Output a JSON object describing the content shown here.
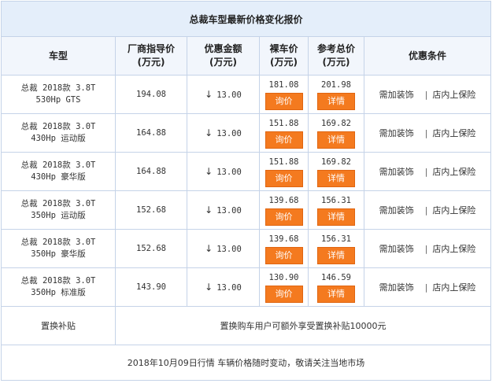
{
  "title": "总裁车型最新价格变化报价",
  "headers": {
    "model": "车型",
    "msrp": [
      "厂商指导价",
      "(万元)"
    ],
    "discount": [
      "优惠金额",
      "(万元)"
    ],
    "net": [
      "裸车价",
      "(万元)"
    ],
    "total": [
      "参考总价",
      "(万元)"
    ],
    "cond": "优惠条件"
  },
  "rows": [
    {
      "model": [
        "总裁 2018款 3.8T",
        "530Hp GTS"
      ],
      "msrp": "194.08",
      "discount": "13.00",
      "net": "181.08",
      "total": "201.98"
    },
    {
      "model": [
        "总裁 2018款 3.0T",
        "430Hp 运动版"
      ],
      "msrp": "164.88",
      "discount": "13.00",
      "net": "151.88",
      "total": "169.82"
    },
    {
      "model": [
        "总裁 2018款 3.0T",
        "430Hp 豪华版"
      ],
      "msrp": "164.88",
      "discount": "13.00",
      "net": "151.88",
      "total": "169.82"
    },
    {
      "model": [
        "总裁 2018款 3.0T",
        "350Hp 运动版"
      ],
      "msrp": "152.68",
      "discount": "13.00",
      "net": "139.68",
      "total": "156.31"
    },
    {
      "model": [
        "总裁 2018款 3.0T",
        "350Hp 豪华版"
      ],
      "msrp": "152.68",
      "discount": "13.00",
      "net": "139.68",
      "total": "156.31"
    },
    {
      "model": [
        "总裁 2018款 3.0T",
        "350Hp 标准版"
      ],
      "msrp": "143.90",
      "discount": "13.00",
      "net": "130.90",
      "total": "146.59"
    }
  ],
  "arrow_glyph": "↓",
  "buttons": {
    "inquire": "询价",
    "detail": "详情"
  },
  "conditions": {
    "a": "需加装饰",
    "sep": "|",
    "b": "店内上保险"
  },
  "subsidy": {
    "label": "置换补贴",
    "text": "置换购车用户可额外享受置换补贴10000元"
  },
  "footer": "2018年10月09日行情 车辆价格随时变动，敬请关注当地市场"
}
